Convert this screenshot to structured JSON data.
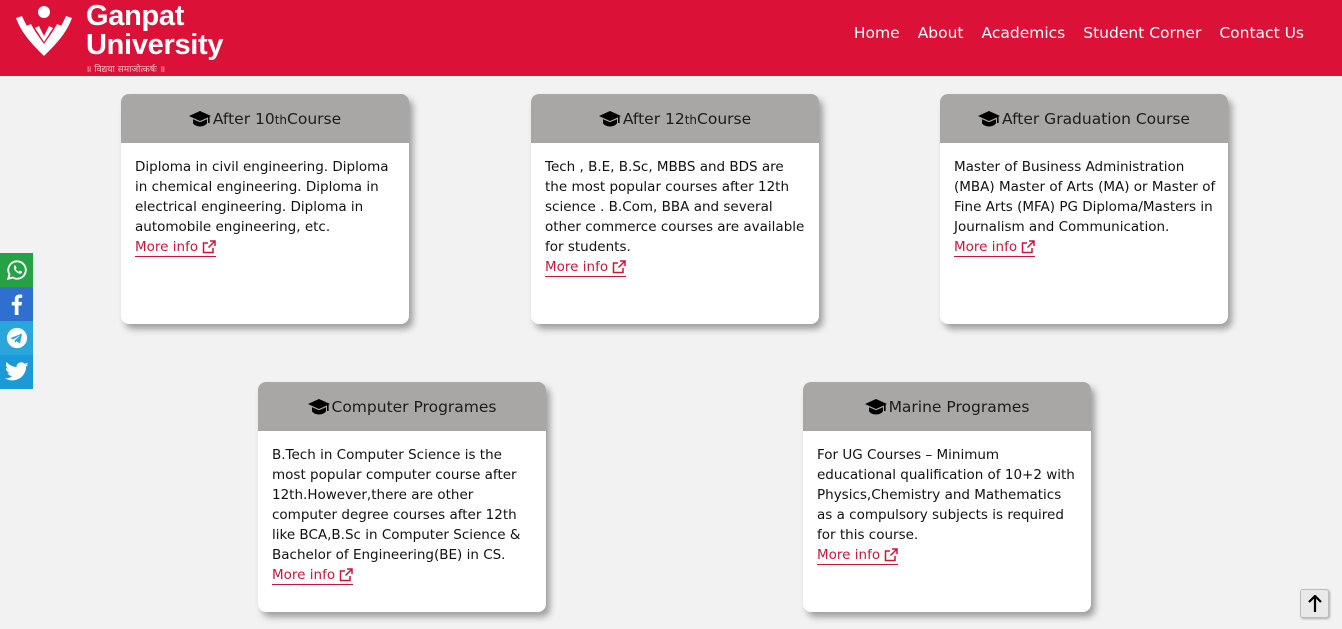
{
  "brand": {
    "name_line1": "Ganpat",
    "name_line2": "University",
    "tagline": "॥ विद्यया समाजोत्कर्षः ॥",
    "color": "#dc1137"
  },
  "nav": {
    "items": [
      "Home",
      "About",
      "Academics",
      "Student Corner",
      "Contact Us"
    ]
  },
  "share": {
    "icons": [
      "whatsapp-icon",
      "facebook-icon",
      "telegram-icon",
      "twitter-icon"
    ]
  },
  "cards": [
    {
      "title_pre": "After 10",
      "title_sup": "th",
      "title_post": "Course",
      "body": "Diploma in civil engineering. Diploma in chemical engineering. Diploma in electrical engineering. Diploma in automobile engineering, etc.",
      "link": "More info"
    },
    {
      "title_pre": "After 12",
      "title_sup": "th",
      "title_post": "Course",
      "body": "Tech , B.E, B.Sc, MBBS and BDS are the most popular courses after 12th science . B.Com, BBA and several other commerce courses are available for students.",
      "link": "More info"
    },
    {
      "title": "After Graduation Course",
      "body": "Master of Business Administration (MBA) Master of Arts (MA) or Master of Fine Arts (MFA) PG Diploma/Masters in Journalism and Communication.",
      "link": "More info"
    },
    {
      "title": "Computer Programes",
      "body": "B.Tech in Computer Science is the most popular computer course after 12th.However,there are other computer degree courses after 12th like BCA,B.Sc in Computer Science & Bachelor of Engineering(BE) in CS.",
      "link": "More info"
    },
    {
      "title": "Marine Programes",
      "body": "For UG Courses – Minimum educational qualification of 10+2 with Physics,Chemistry and Mathematics as a compulsory subjects is required for this course.",
      "link": "More info"
    }
  ]
}
